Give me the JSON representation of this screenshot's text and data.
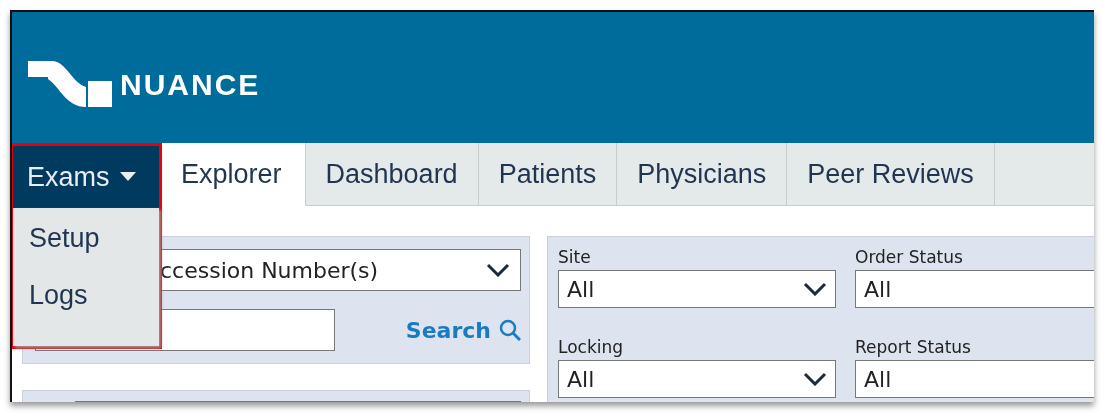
{
  "header": {
    "brand": "NUANCE"
  },
  "menu": {
    "label": "Exams",
    "expanded": true,
    "highlighted": true,
    "items": [
      "Setup",
      "Logs"
    ]
  },
  "tabs": [
    {
      "label": "Explorer",
      "selected": true
    },
    {
      "label": "Dashboard",
      "selected": false
    },
    {
      "label": "Patients",
      "selected": false
    },
    {
      "label": "Physicians",
      "selected": false
    },
    {
      "label": "Peer Reviews",
      "selected": false
    }
  ],
  "search_panel": {
    "type_select": "ccession Number(s)",
    "search_link": "Search"
  },
  "filters": [
    {
      "label": "Site",
      "value": "All"
    },
    {
      "label": "Order Status",
      "value": "All"
    },
    {
      "label": "Locking",
      "value": "All"
    },
    {
      "label": "Report Status",
      "value": "All"
    }
  ]
}
